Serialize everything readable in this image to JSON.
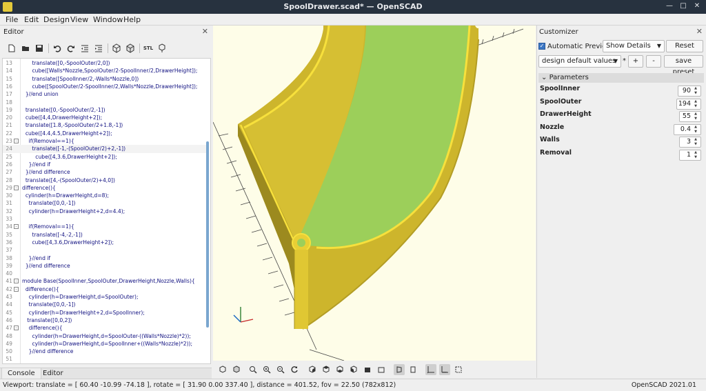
{
  "window": {
    "title": "SpoolDrawer.scad* — OpenSCAD"
  },
  "menubar": {
    "items": [
      "File",
      "Edit",
      "Design",
      "View",
      "Window",
      "Help"
    ]
  },
  "editor": {
    "title": "Editor",
    "toolbar_icons": [
      "new-file-icon",
      "open-file-icon",
      "save-icon",
      "undo-icon",
      "redo-icon",
      "unindent-icon",
      "indent-icon",
      "preview-icon",
      "render-icon",
      "send-to-print-icon",
      "export-stl-icon",
      "export-3d-icon"
    ],
    "lines": [
      {
        "n": "13",
        "text": "      translate([0,-SpoolOuter/2,0])",
        "fold": ""
      },
      {
        "n": "14",
        "text": "      cube([Walls*Nozzle,SpoolOuter/2-SpoolInner/2,DrawerHeight]);",
        "fold": ""
      },
      {
        "n": "15",
        "text": "      translate([SpoolInner/2,-Walls*Nozzle,0])",
        "fold": ""
      },
      {
        "n": "16",
        "text": "      cube([SpoolOuter/2-SpoolInner/2,Walls*Nozzle,DrawerHeight]);",
        "fold": ""
      },
      {
        "n": "17",
        "text": "  }//end union",
        "fold": ""
      },
      {
        "n": "18",
        "text": "",
        "fold": ""
      },
      {
        "n": "19",
        "text": "  translate([0,-SpoolOuter/2,-1])",
        "fold": ""
      },
      {
        "n": "20",
        "text": "  cube([4,4,DrawerHeight+2]);",
        "fold": ""
      },
      {
        "n": "21",
        "text": "  translate([1.8,-SpoolOuter/2+1.8,-1])",
        "fold": ""
      },
      {
        "n": "22",
        "text": "  cube([4.4,4.5,DrawerHeight+2]);",
        "fold": ""
      },
      {
        "n": "23",
        "text": "    if(Removal==1){",
        "fold": "-"
      },
      {
        "n": "24",
        "text": "      translate([-1,-(SpoolOuter/2)+2,-1])",
        "fold": ""
      },
      {
        "n": "25",
        "text": "        cube([4,3.6,DrawerHeight+2]);",
        "fold": ""
      },
      {
        "n": "26",
        "text": "    }//end if",
        "fold": ""
      },
      {
        "n": "27",
        "text": "  }//end difference",
        "fold": ""
      },
      {
        "n": "28",
        "text": "  translate([4,-(SpoolOuter/2)+4,0])",
        "fold": ""
      },
      {
        "n": "29",
        "text": "difference(){",
        "fold": "-"
      },
      {
        "n": "30",
        "text": "  cylinder(h=DrawerHeight,d=8);",
        "fold": ""
      },
      {
        "n": "31",
        "text": "    translate([0,0,-1])",
        "fold": ""
      },
      {
        "n": "32",
        "text": "    cylinder(h=DrawerHeight+2,d=4.4);",
        "fold": ""
      },
      {
        "n": "33",
        "text": "",
        "fold": ""
      },
      {
        "n": "34",
        "text": "    if(Removal==1){",
        "fold": "-"
      },
      {
        "n": "35",
        "text": "      translate([-4,-2,-1])",
        "fold": ""
      },
      {
        "n": "36",
        "text": "      cube([4,3.6,DrawerHeight+2]);",
        "fold": ""
      },
      {
        "n": "37",
        "text": "",
        "fold": ""
      },
      {
        "n": "38",
        "text": "    }//end if",
        "fold": ""
      },
      {
        "n": "39",
        "text": "  }//end difference",
        "fold": ""
      },
      {
        "n": "40",
        "text": "",
        "fold": ""
      },
      {
        "n": "41",
        "text": "module Base(SpoolInner,SpoolOuter,DrawerHeight,Nozzle,Walls){",
        "fold": "-"
      },
      {
        "n": "42",
        "text": "  difference(){",
        "fold": "-"
      },
      {
        "n": "43",
        "text": "    cylinder(h=DrawerHeight,d=SpoolOuter);",
        "fold": ""
      },
      {
        "n": "44",
        "text": "    translate([0,0,-1])",
        "fold": ""
      },
      {
        "n": "45",
        "text": "    cylinder(h=DrawerHeight+2,d=SpoolInner);",
        "fold": ""
      },
      {
        "n": "46",
        "text": "   translate([0,0,2])",
        "fold": ""
      },
      {
        "n": "47",
        "text": "    difference(){",
        "fold": "-"
      },
      {
        "n": "48",
        "text": "      cylinder(h=DrawerHeight,d=SpoolOuter-((Walls*Nozzle)*2));",
        "fold": ""
      },
      {
        "n": "49",
        "text": "      cylinder(h=DrawerHeight,d=SpoolInner+((Walls*Nozzle)*2));",
        "fold": ""
      },
      {
        "n": "50",
        "text": "    }//end difference",
        "fold": ""
      },
      {
        "n": "51",
        "text": "",
        "fold": ""
      }
    ]
  },
  "bottom_tabs": [
    "Console",
    "Editor"
  ],
  "viewport": {
    "toolbar_icons": [
      "preview-icon",
      "render-icon",
      "view-all-icon",
      "zoom-in-icon",
      "zoom-out-icon",
      "reset-view-icon",
      "view-right-icon",
      "view-top-icon",
      "view-bottom-icon",
      "view-left-icon",
      "view-front-icon",
      "view-back-icon",
      "perspective-icon",
      "orthogonal-icon",
      "show-axes-icon",
      "show-scale-icon",
      "show-edges-icon"
    ],
    "colors": {
      "background": "#fefde8",
      "wall": "#d9c131",
      "floor": "#9ccf5a",
      "edge": "#f7e03c"
    }
  },
  "customizer": {
    "title": "Customizer",
    "auto_preview_label": "Automatic Preview",
    "details_value": "Show Details",
    "reset_label": "Reset",
    "preset_value": "design default values",
    "preset_asterisk": "*",
    "add_label": "+",
    "remove_label": "-",
    "save_preset_label": "save preset",
    "params_header": "Parameters",
    "params": [
      {
        "name": "SpoolInner",
        "value": "90"
      },
      {
        "name": "SpoolOuter",
        "value": "194"
      },
      {
        "name": "DrawerHeight",
        "value": "55"
      },
      {
        "name": "Nozzle",
        "value": "0.4"
      },
      {
        "name": "Walls",
        "value": "3"
      },
      {
        "name": "Removal",
        "value": "1"
      }
    ]
  },
  "status": {
    "left": "Viewport: translate = [ 60.40 -10.99 -74.18 ], rotate = [ 31.90 0.00 337.40 ], distance = 401.52, fov = 22.50 (782x812)",
    "right": "OpenSCAD 2021.01"
  }
}
